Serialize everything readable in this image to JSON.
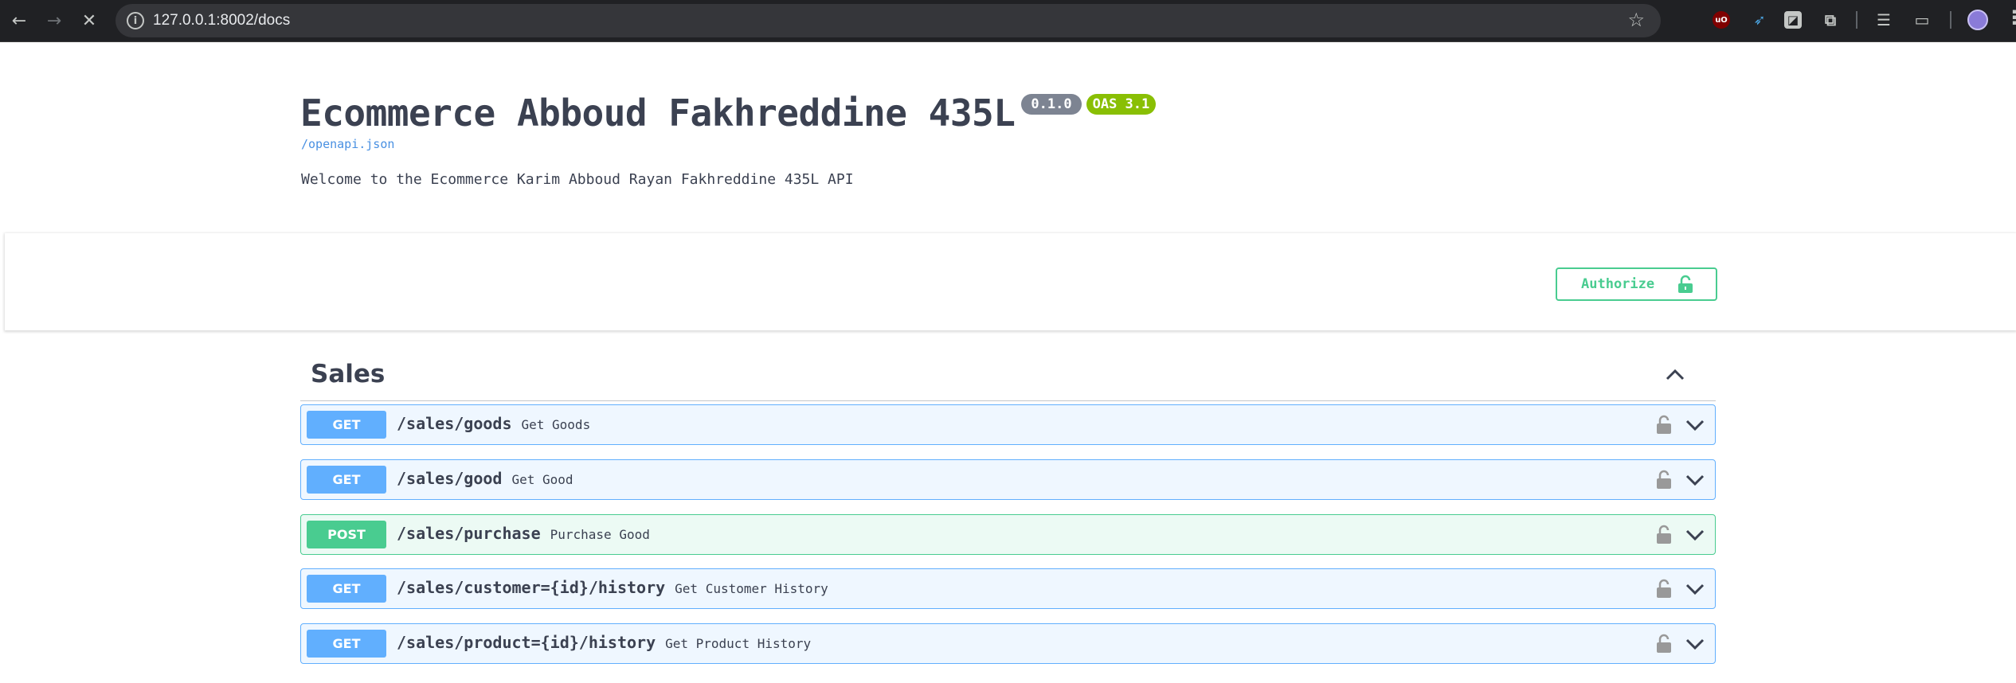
{
  "browser": {
    "url": "127.0.0.1:8002/docs",
    "icons": [
      "back-arrow-icon",
      "forward-arrow-icon",
      "stop-loading-icon",
      "site-info-icon",
      "bookmark-star-icon",
      "ublock-extension-icon",
      "bird-extension-icon",
      "sheet-extension-icon",
      "extensions-puzzle-icon",
      "reading-list-icon",
      "reader-mode-icon",
      "profile-avatar",
      "menu-dots-icon"
    ]
  },
  "info": {
    "title": "Ecommerce Abboud Fakhreddine 435L",
    "version": "0.1.0",
    "oas": "OAS 3.1",
    "openapi_link": "/openapi.json",
    "description": "Welcome to the Ecommerce Karim Abboud Rayan Fakhreddine 435L API"
  },
  "auth": {
    "authorize_label": "Authorize"
  },
  "tag": {
    "name": "Sales"
  },
  "operations": [
    {
      "method": "GET",
      "path": "/sales/goods",
      "summary": "Get Goods"
    },
    {
      "method": "GET",
      "path": "/sales/good",
      "summary": "Get Good"
    },
    {
      "method": "POST",
      "path": "/sales/purchase",
      "summary": "Purchase Good"
    },
    {
      "method": "GET",
      "path": "/sales/customer={id}/history",
      "summary": "Get Customer History"
    },
    {
      "method": "GET",
      "path": "/sales/product={id}/history",
      "summary": "Get Product History"
    }
  ],
  "colors": {
    "get": "#61affe",
    "post": "#49cc90",
    "authorize": "#49cc90",
    "version_badge": "#7d8492",
    "oas_badge": "#89bf04",
    "link": "#4990e2"
  }
}
